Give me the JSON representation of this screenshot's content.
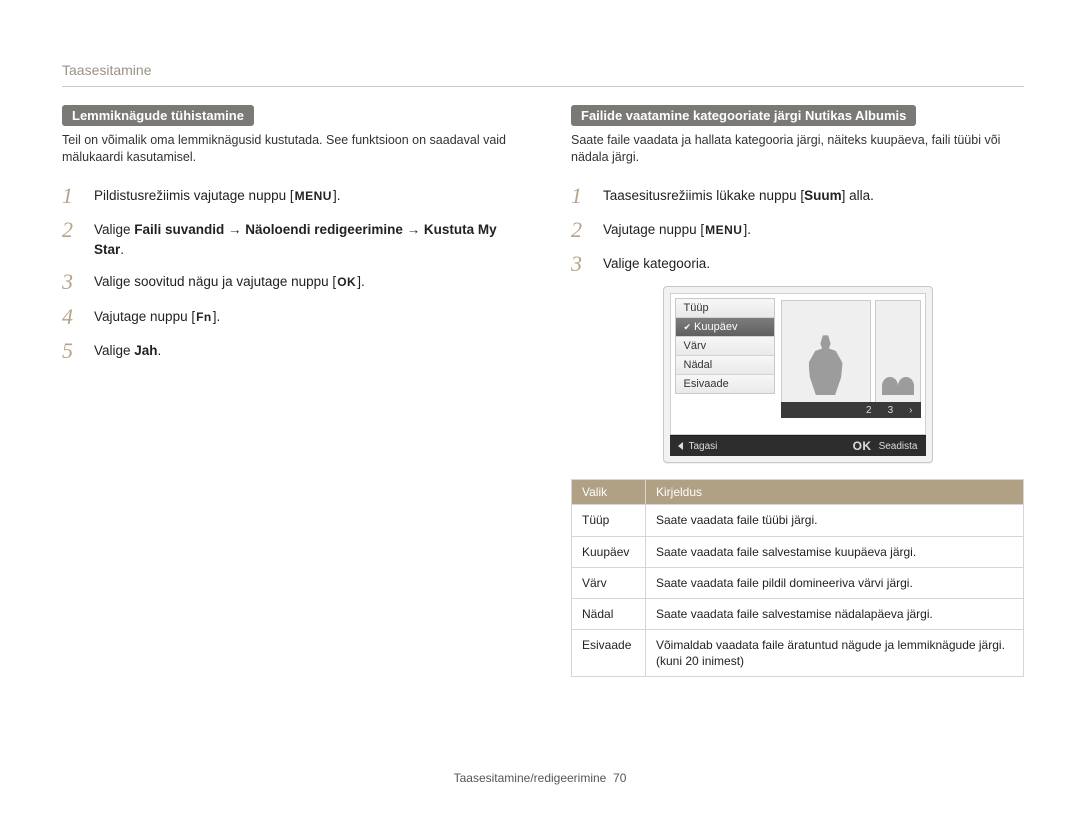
{
  "header": {
    "title": "Taasesitamine"
  },
  "left": {
    "heading": "Lemmiknägude tühistamine",
    "intro": "Teil on võimalik oma lemmiknägusid kustutada. See funktsioon on saadaval vaid mälukaardi kasutamisel.",
    "steps": [
      {
        "n": "1",
        "pre": "Pildistusrežiimis vajutage nuppu [",
        "btn": "MENU",
        "post": "]."
      },
      {
        "n": "2",
        "html": "Valige <strong>Faili suvandid → Näoloendi redigeerimine → Kustuta My Star</strong>."
      },
      {
        "n": "3",
        "pre": "Valige soovitud nägu ja vajutage nuppu [",
        "btn": "OK",
        "post": "]."
      },
      {
        "n": "4",
        "pre": "Vajutage nuppu [",
        "btn": "Fn",
        "post": "]."
      },
      {
        "n": "5",
        "html": "Valige <strong>Jah</strong>."
      }
    ]
  },
  "right": {
    "heading": "Failide vaatamine kategooriate järgi Nutikas Albumis",
    "intro": "Saate faile vaadata ja hallata kategooria järgi, näiteks kuupäeva, faili tüübi või nädala järgi.",
    "steps": [
      {
        "n": "1",
        "html": "Taasesitusrežiimis lükake nuppu [<strong>Suum</strong>] alla."
      },
      {
        "n": "2",
        "pre": "Vajutage nuppu [",
        "btn": "MENU",
        "post": "]."
      },
      {
        "n": "3",
        "html": "Valige kategooria."
      }
    ],
    "lcd": {
      "menu": [
        "Tüüp",
        "Kuupäev",
        "Värv",
        "Nädal",
        "Esivaade"
      ],
      "selected_index": 1,
      "strip_nums": [
        "2",
        "3",
        "›"
      ],
      "footer_back": "Tagasi",
      "footer_ok": "OK",
      "footer_set": "Seadista"
    },
    "table": {
      "head": [
        "Valik",
        "Kirjeldus"
      ],
      "rows": [
        [
          "Tüüp",
          "Saate vaadata faile tüübi järgi."
        ],
        [
          "Kuupäev",
          "Saate vaadata faile salvestamise kuupäeva järgi."
        ],
        [
          "Värv",
          "Saate vaadata faile pildil domineeriva värvi järgi."
        ],
        [
          "Nädal",
          "Saate vaadata faile salvestamise nädalapäeva järgi."
        ],
        [
          "Esivaade",
          "Võimaldab vaadata faile äratuntud nägude ja lemmiknägude järgi. (kuni 20 inimest)"
        ]
      ]
    }
  },
  "footer": {
    "section": "Taasesitamine/redigeerimine",
    "page": "70"
  }
}
